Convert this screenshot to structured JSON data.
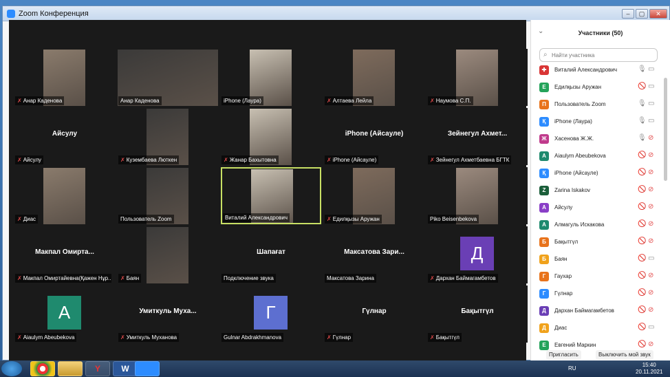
{
  "window": {
    "title": "Zoom Конференция"
  },
  "colors": {
    "accent": "#2d8cff",
    "muted": "#e34b4b",
    "active_border": "#c8e064"
  },
  "grid": {
    "tiles": [
      {
        "label": "Анар Каденова",
        "muted": true,
        "video": true
      },
      {
        "label": "Анар Каденова",
        "muted": false,
        "video": true
      },
      {
        "label": "iPhone (Лаура)",
        "muted": false,
        "video": true
      },
      {
        "label": "Алтаева Лейла",
        "muted": true,
        "video": true
      },
      {
        "label": "Наумова С.П.",
        "muted": true,
        "video": true
      },
      {
        "label": "Айсулу",
        "muted": true,
        "bigname": "Айсулу"
      },
      {
        "label": "Кузембаева Люткен",
        "muted": true,
        "video": true
      },
      {
        "label": "Жанар Бахытовна",
        "muted": true,
        "video": true
      },
      {
        "label": "iPhone (Айсауле)",
        "muted": true,
        "bigname": "iPhone (Айсауле)"
      },
      {
        "label": "Зейнегул Ахметбаевна БГТК",
        "muted": true,
        "bigname": "Зейнегул Ахмет..."
      },
      {
        "label": "Диас",
        "muted": true,
        "video": true
      },
      {
        "label": "Пользователь Zoom",
        "muted": false,
        "video": true
      },
      {
        "label": "Виталий Александрович",
        "muted": false,
        "video": true,
        "active": true
      },
      {
        "label": "Едилқызы Аружан",
        "muted": true,
        "video": true
      },
      {
        "label": "Piko Beisenbekova",
        "muted": false,
        "video": true
      },
      {
        "label": "Макпал Омиртайевна(Қажен Нұр...",
        "muted": true,
        "bigname": "Макпал Омирта..."
      },
      {
        "label": "Баян",
        "muted": true,
        "video": true
      },
      {
        "label": "Подключение звука",
        "muted": false,
        "bigname": "Шапағат"
      },
      {
        "label": "Максатова Зарина",
        "muted": false,
        "bigname": "Максатова Зари..."
      },
      {
        "label": "Дархан Баймагамбетов",
        "muted": true,
        "avatar": "Д",
        "avatar_color": "#6a3fb5"
      },
      {
        "label": "Aiaulym Abeubekova",
        "muted": true,
        "avatar": "A",
        "avatar_color": "#1f8a6e"
      },
      {
        "label": "Умиткуль Муханова",
        "muted": true,
        "bigname": "Умиткуль Муха..."
      },
      {
        "label": "Gulnar Abdrakhmanova",
        "muted": false,
        "avatar": "Г",
        "avatar_color": "#5d6fd0"
      },
      {
        "label": "Гүлнар",
        "muted": true,
        "bigname": "Гүлнар"
      },
      {
        "label": "Бақытгүл",
        "muted": true,
        "bigname": "Бақытгүл"
      }
    ]
  },
  "panel": {
    "title": "Участники (50)",
    "search_placeholder": "Найти участника",
    "participants": [
      {
        "initial": "✚",
        "color": "#d93636",
        "name": "Виталий Александрович",
        "mic_on": true,
        "cam_on": true
      },
      {
        "initial": "Е",
        "color": "#24a35a",
        "name": "Едилқызы Аружан",
        "mic_on": false,
        "cam_on": true
      },
      {
        "initial": "П",
        "color": "#e8731c",
        "name": "Пользователь Zoom",
        "mic_on": true,
        "cam_on": true
      },
      {
        "initial": "Қ",
        "color": "#2d8cff",
        "name": "iPhone (Лаура)",
        "mic_on": true,
        "cam_on": true
      },
      {
        "initial": "Ж",
        "color": "#c03b8c",
        "name": "Хасенова Ж.Ж.",
        "mic_on": true,
        "cam_on": false
      },
      {
        "initial": "A",
        "color": "#1f8a6e",
        "name": "Aiaulym Abeubekova",
        "mic_on": false,
        "cam_on": false
      },
      {
        "initial": "Қ",
        "color": "#2d8cff",
        "name": "iPhone (Айсауле)",
        "mic_on": false,
        "cam_on": false
      },
      {
        "initial": "Z",
        "color": "#1b5e3a",
        "name": "Zarina Iskakov",
        "mic_on": false,
        "cam_on": false
      },
      {
        "initial": "А",
        "color": "#8a3fc7",
        "name": "Айсулу",
        "mic_on": false,
        "cam_on": false
      },
      {
        "initial": "А",
        "color": "#1f8a6e",
        "name": "Алмагуль Искакова",
        "mic_on": false,
        "cam_on": false
      },
      {
        "initial": "Б",
        "color": "#e8731c",
        "name": "Бақытгүл",
        "mic_on": false,
        "cam_on": false
      },
      {
        "initial": "Б",
        "color": "#f0a21c",
        "name": "Баян",
        "mic_on": false,
        "cam_on": true
      },
      {
        "initial": "Г",
        "color": "#e8731c",
        "name": "Гаухар",
        "mic_on": false,
        "cam_on": false
      },
      {
        "initial": "Г",
        "color": "#2d8cff",
        "name": "Гүлнар",
        "mic_on": false,
        "cam_on": false
      },
      {
        "initial": "Д",
        "color": "#6a3fb5",
        "name": "Дархан Баймагамбетов",
        "mic_on": false,
        "cam_on": false
      },
      {
        "initial": "Д",
        "color": "#f0a21c",
        "name": "Диас",
        "mic_on": false,
        "cam_on": true
      },
      {
        "initial": "Е",
        "color": "#24a35a",
        "name": "Евгений Маркин",
        "mic_on": false,
        "cam_on": false
      }
    ],
    "invite_label": "Пригласить",
    "mute_self_label": "Выключить мой звук"
  },
  "taskbar": {
    "lang": "RU",
    "time": "15:40",
    "date": "20.11.2021",
    "word_label": "W"
  }
}
